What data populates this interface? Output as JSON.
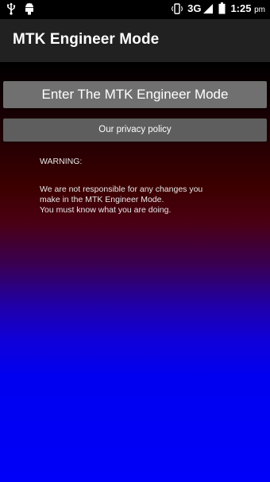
{
  "status_bar": {
    "left_icons": [
      "usb-icon",
      "android-debug-icon"
    ],
    "network": "3G",
    "time": "1:25",
    "ampm": "pm",
    "right_icons": [
      "vibrate-icon",
      "signal-icon",
      "battery-icon"
    ]
  },
  "app_bar": {
    "title": "MTK Engineer Mode"
  },
  "main": {
    "enter_button_label": "Enter The MTK Engineer Mode",
    "privacy_button_label": "Our privacy policy",
    "warning_title": "WARNING:",
    "warning_lines": [
      "We are not responsible for any changes you",
      "make in the MTK Engineer Mode.",
      "You must know what you are doing."
    ]
  },
  "colors": {
    "app_bar": "#212121",
    "button": "#707070",
    "gradient_top": "#000000",
    "gradient_mid": "#3c0000",
    "gradient_bottom": "#0000f8"
  }
}
